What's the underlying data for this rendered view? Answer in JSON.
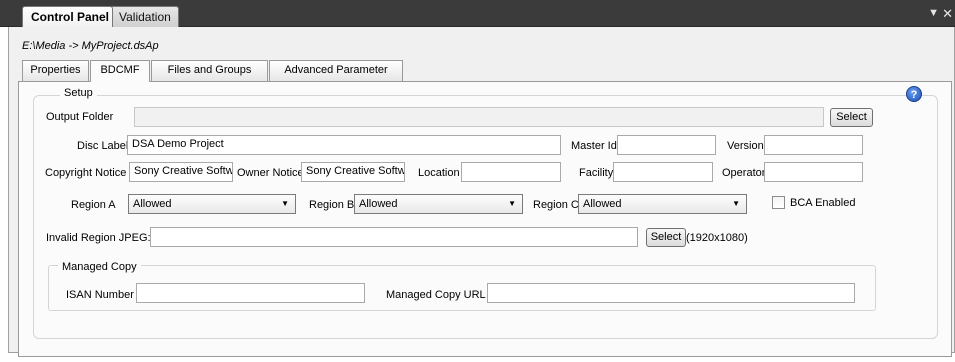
{
  "panel_tabs": {
    "control_panel": "Control Panel",
    "validation": "Validation"
  },
  "titlebar": {
    "menu_glyph": "▼",
    "close_glyph": "✕"
  },
  "project_path": "E:\\Media -> MyProject.dsAp",
  "inner_tabs": {
    "properties": "Properties",
    "bdcmf": "BDCMF",
    "files_groups": "Files and Groups",
    "advanced": "Advanced Parameter"
  },
  "setup": {
    "legend": "Setup",
    "help_glyph": "?",
    "output_folder_label": "Output Folder",
    "output_folder_value": "",
    "select_label": "Select",
    "disc_label_label": "Disc Label",
    "disc_label_value": "DSA Demo Project",
    "master_id_label": "Master Id",
    "master_id_value": "",
    "version_label": "Version",
    "version_value": "",
    "copyright_label": "Copyright Notice",
    "copyright_value": "Sony Creative Softwa",
    "owner_label": "Owner Notice",
    "owner_value": "Sony Creative Softwa",
    "location_label": "Location",
    "location_value": "",
    "facility_label": "Facility",
    "facility_value": "",
    "operator_label": "Operator",
    "operator_value": "",
    "region_a_label": "Region A",
    "region_a_value": "Allowed",
    "region_b_label": "Region B",
    "region_b_value": "Allowed",
    "region_c_label": "Region C",
    "region_c_value": "Allowed",
    "bca_label": "BCA Enabled",
    "bca_checked": false,
    "invalid_region_label": "Invalid Region JPEG:",
    "invalid_region_value": "",
    "resolution_hint": "(1920x1080)",
    "managed_copy": {
      "legend": "Managed Copy",
      "isan_label": "ISAN Number",
      "isan_value": "",
      "url_label": "Managed Copy URL",
      "url_value": ""
    }
  }
}
